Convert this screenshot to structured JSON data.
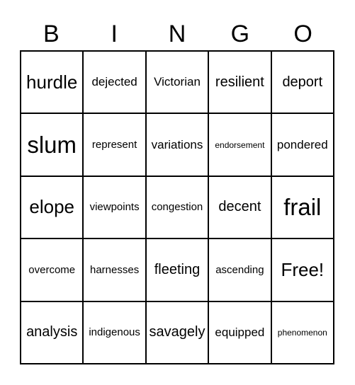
{
  "header": {
    "letters": [
      "B",
      "I",
      "N",
      "G",
      "O"
    ]
  },
  "card": {
    "rows": [
      [
        "hurdle",
        "dejected",
        "Victorian",
        "resilient",
        "deport"
      ],
      [
        "slum",
        "represent",
        "variations",
        "endorsement",
        "pondered"
      ],
      [
        "elope",
        "viewpoints",
        "congestion",
        "decent",
        "frail"
      ],
      [
        "overcome",
        "harnesses",
        "fleeting",
        "ascending",
        "Free!"
      ],
      [
        "analysis",
        "indigenous",
        "savagely",
        "equipped",
        "phenomenon"
      ]
    ]
  }
}
